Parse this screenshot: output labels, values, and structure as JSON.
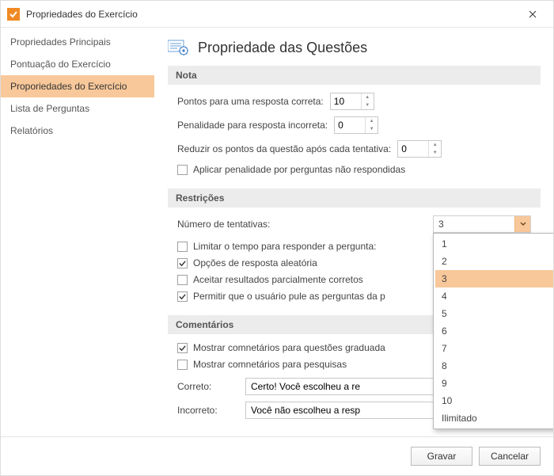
{
  "window": {
    "title": "Propriedades do Exercício"
  },
  "sidebar": {
    "items": [
      {
        "label": "Propriedades Principais",
        "selected": false
      },
      {
        "label": "Pontuação do Exercício",
        "selected": false
      },
      {
        "label": "Proporiedades do Exercício",
        "selected": true
      },
      {
        "label": "Lista de Perguntas",
        "selected": false
      },
      {
        "label": "Relatórios",
        "selected": false
      }
    ]
  },
  "page": {
    "title": "Propriedade das Questões"
  },
  "sections": {
    "nota": {
      "header": "Nota",
      "points_label": "Pontos para uma resposta correta:",
      "points_value": "10",
      "penalty_label": "Penalidade para resposta incorreta:",
      "penalty_value": "0",
      "reduce_label": "Reduzir os pontos da questão após cada tentativa:",
      "reduce_value": "0",
      "apply_penalty_label": "Aplicar penalidade por perguntas não respondidas",
      "apply_penalty_checked": false
    },
    "restricoes": {
      "header": "Restrições",
      "attempts_label": "Número de tentativas:",
      "attempts_value": "3",
      "attempts_options": [
        "1",
        "2",
        "3",
        "4",
        "5",
        "6",
        "7",
        "8",
        "9",
        "10",
        "Ilimitado"
      ],
      "limit_time_label": "Limitar o tempo para responder a pergunta:",
      "limit_time_checked": false,
      "random_label": "Opções de resposta aleatória",
      "random_checked": true,
      "partial_label": "Aceitar resultados parcialmente corretos",
      "partial_checked": false,
      "skip_label": "Permitir que o usuário pule as perguntas da p",
      "skip_checked": true
    },
    "comentarios": {
      "header": "Comentários",
      "show_graded_label": "Mostrar comnetários para questões graduada",
      "show_graded_checked": true,
      "show_survey_label": "Mostrar comnetários para pesquisas",
      "show_survey_checked": false,
      "correct_label": "Correto:",
      "correct_value": "Certo! Você escolheu a re",
      "incorrect_label": "Incorreto:",
      "incorrect_value": "Você não escolheu a resp"
    }
  },
  "footer": {
    "save": "Gravar",
    "cancel": "Cancelar"
  }
}
